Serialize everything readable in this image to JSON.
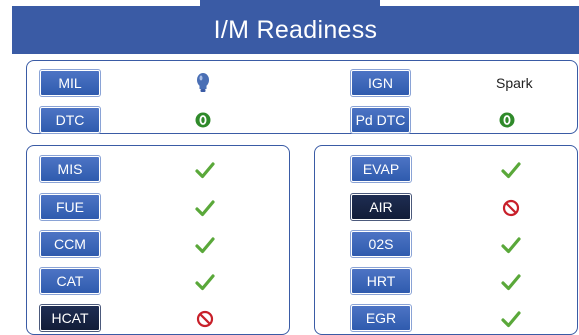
{
  "header": {
    "title": "I/M Readiness"
  },
  "summary": {
    "mil": {
      "label": "MIL",
      "status": "bulb-icon"
    },
    "ign": {
      "label": "IGN",
      "value": "Spark"
    },
    "dtc": {
      "label": "DTC",
      "status": "ok-circle-icon"
    },
    "pd_dtc": {
      "label": "Pd DTC",
      "status": "ok-circle-icon"
    }
  },
  "monitors_left": [
    {
      "label": "MIS",
      "status": "check-icon",
      "highlight": false
    },
    {
      "label": "FUE",
      "status": "check-icon",
      "highlight": false
    },
    {
      "label": "CCM",
      "status": "check-icon",
      "highlight": false
    },
    {
      "label": "CAT",
      "status": "check-icon",
      "highlight": false
    },
    {
      "label": "HCAT",
      "status": "not-supported-icon",
      "highlight": true
    }
  ],
  "monitors_right": [
    {
      "label": "EVAP",
      "status": "check-icon",
      "highlight": false
    },
    {
      "label": "AIR",
      "status": "not-supported-icon",
      "highlight": true
    },
    {
      "label": "02S",
      "status": "check-icon",
      "highlight": false
    },
    {
      "label": "HRT",
      "status": "check-icon",
      "highlight": false
    },
    {
      "label": "EGR",
      "status": "check-icon",
      "highlight": false
    }
  ],
  "colors": {
    "accent": "#3a5ba5",
    "check": "#5aa83a",
    "no": "#c8202a",
    "ok": "#2f8a2a"
  }
}
